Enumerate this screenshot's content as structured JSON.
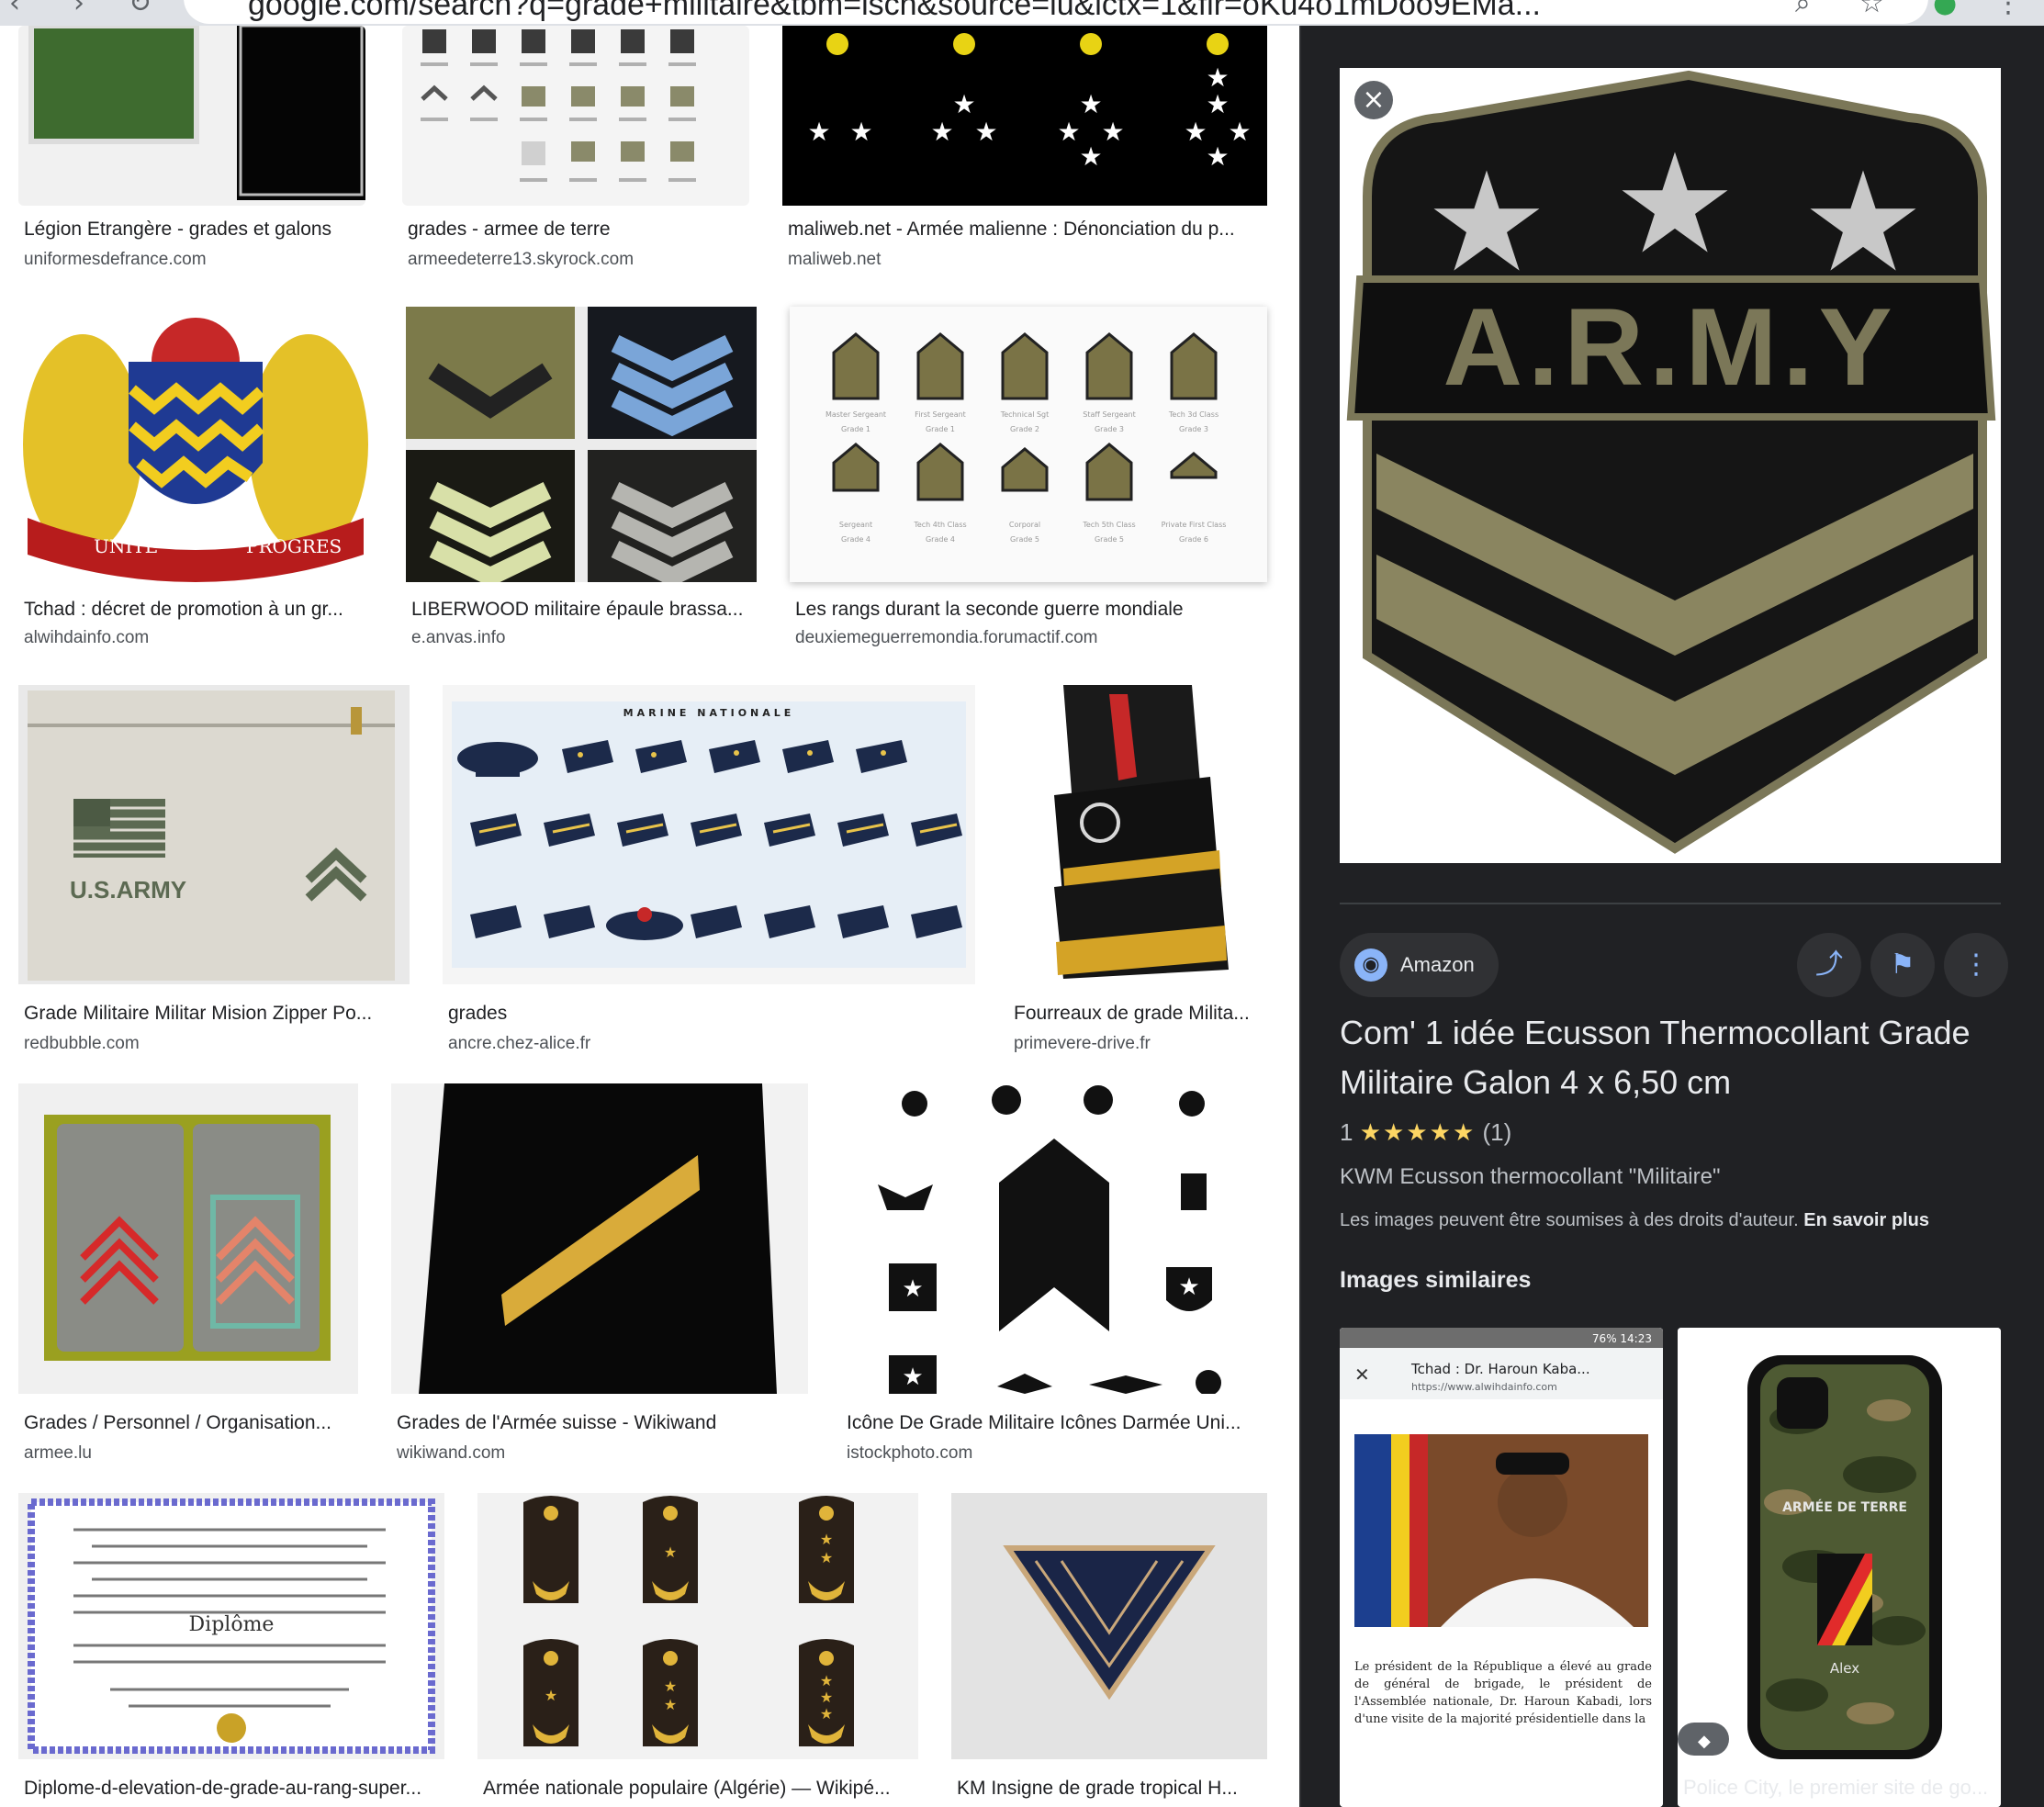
{
  "browser": {
    "url": "google.com/search?q=grade+militaire&tbm=isch&source=iu&ictx=1&fir=oKu4o1mDoo9EMa..."
  },
  "results": [
    {
      "caption": "Légion Etrangère - grades et galons",
      "source": "uniformesdefrance.com"
    },
    {
      "caption": "grades - armee de terre",
      "source": "armeedeterre13.skyrock.com"
    },
    {
      "caption": "maliweb.net - Armée malienne : Dénonciation du p...",
      "source": "maliweb.net"
    },
    {
      "caption": "Tchad : décret de promotion à un gr...",
      "source": "alwihdainfo.com"
    },
    {
      "caption": "LIBERWOOD militaire épaule brassa...",
      "source": "e.anvas.info"
    },
    {
      "caption": "Les rangs durant la seconde guerre mondiale",
      "source": "deuxiemeguerremondia.forumactif.com"
    },
    {
      "caption": "Grade Militaire Militar Mision Zipper Po...",
      "source": "redbubble.com"
    },
    {
      "caption": "grades",
      "source": "ancre.chez-alice.fr"
    },
    {
      "caption": "Fourreaux de grade Milita...",
      "source": "primevere-drive.fr"
    },
    {
      "caption": "Grades / Personnel / Organisation...",
      "source": "armee.lu"
    },
    {
      "caption": "Grades de l'Armée suisse - Wikiwand",
      "source": "wikiwand.com"
    },
    {
      "caption": "Icône De Grade Militaire Icônes Darmée Uni...",
      "source": "istockphoto.com"
    },
    {
      "caption": "Diplome-d-elevation-de-grade-au-rang-super...",
      "source": ""
    },
    {
      "caption": "Armée nationale populaire (Algérie) — Wikipé...",
      "source": ""
    },
    {
      "caption": "KM Insigne de grade tropical H...",
      "source": ""
    }
  ],
  "thumb_text": {
    "badge_word": "A.R.M.Y",
    "bag_text": "U.S.ARMY",
    "marine_header": "MARINE NATIONALE",
    "coat_left": "UNITE",
    "coat_right": "PROGRES",
    "wwii_ranks": [
      "Master Sergeant",
      "First Sergeant",
      "Technical Sgt",
      "Staff Sergeant",
      "Tech 3d Class",
      "Sergeant",
      "Tech 4th Class",
      "Corporal",
      "Tech 5th Class",
      "Private First Class"
    ],
    "wwii_grades": [
      "Grade 1",
      "Grade 1",
      "Grade 2",
      "Grade 3",
      "Grade 3",
      "Grade 4",
      "Grade 4",
      "Grade 5",
      "Grade 5",
      "Grade 6"
    ],
    "diploma_word": "Diplôme",
    "case_text": "ARMÉE DE TERRE",
    "case_name": "Alex",
    "news_title": "Tchad : Dr. Haroun Kaba...",
    "news_url": "https://www.alwihdainfo.com",
    "news_status": "76% 14:23",
    "news_body": "Le président de la République a élevé au grade de général de brigade, le président de l'Assemblée nationale, Dr. Haroun Kabadi, lors d'une visite de la majorité présidentielle dans la"
  },
  "panel": {
    "close_icon": "×",
    "source_label": "Amazon",
    "title": "Com' 1 idée Ecusson Thermocollant Grade Militaire Galon 4 x 6,50 cm",
    "rating_value": "1",
    "rating_stars": "★★★★★",
    "rating_count": "(1)",
    "subtitle": "KWM Ecusson thermocollant \"Militaire\"",
    "rights_text": "Les images peuvent être soumises à des droits d'auteur.",
    "rights_link": "En savoir plus",
    "similar_heading": "Images similaires",
    "similar": [
      {
        "caption": ""
      },
      {
        "caption": "Police City, le premier site de go..."
      }
    ]
  },
  "colors": {
    "panel_bg": "#202124",
    "patch_olive": "#8a8560",
    "patch_dark": "#151515",
    "link_blue": "#8ab4f8"
  }
}
